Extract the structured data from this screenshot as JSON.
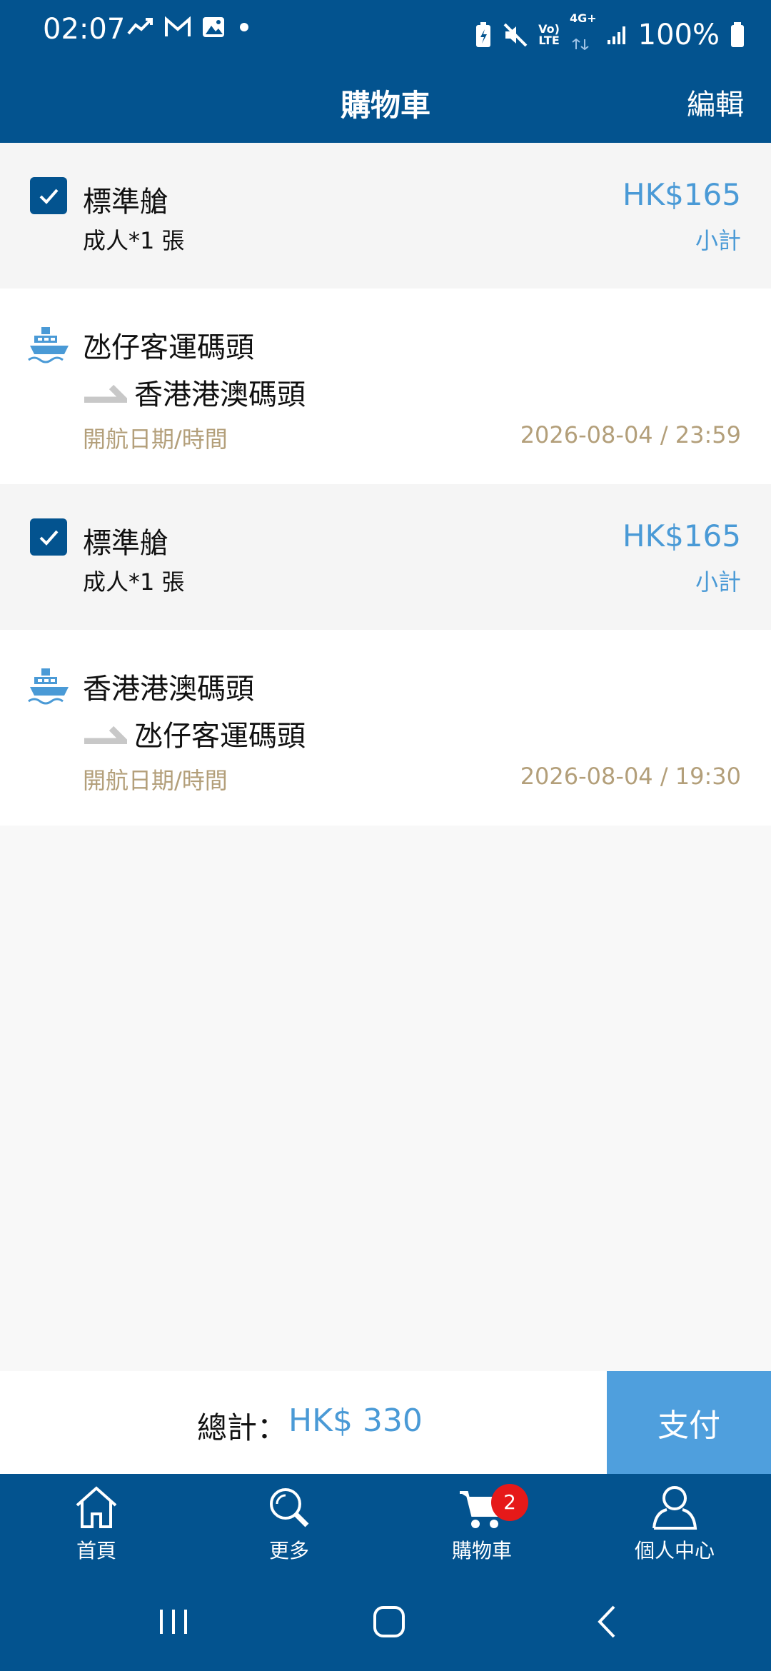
{
  "status_bar": {
    "time": "02:07",
    "battery": "100%",
    "volte_label_top": "Vo)",
    "volte_label_bottom": "LTE",
    "network_label": "4G+"
  },
  "header": {
    "title": "購物車",
    "edit_label": "編輯"
  },
  "cart_items": [
    {
      "title": "標準艙",
      "quantity": "成人*1 張",
      "price": "HK$165",
      "subtotal_label": "小計",
      "route": {
        "from": "氹仔客運碼頭",
        "to": "香港港澳碼頭",
        "datetime_label": "開航日期/時間",
        "datetime": "2026-08-04 / 23:59"
      }
    },
    {
      "title": "標準艙",
      "quantity": "成人*1 張",
      "price": "HK$165",
      "subtotal_label": "小計",
      "route": {
        "from": "香港港澳碼頭",
        "to": "氹仔客運碼頭",
        "datetime_label": "開航日期/時間",
        "datetime": "2026-08-04 / 19:30"
      }
    }
  ],
  "total": {
    "label": "總計：",
    "amount": "HK$ 330",
    "pay_label": "支付"
  },
  "bottom_nav": {
    "items": [
      {
        "label": "首頁",
        "icon": "home-icon"
      },
      {
        "label": "更多",
        "icon": "search-icon"
      },
      {
        "label": "購物車",
        "icon": "cart-icon",
        "badge": "2"
      },
      {
        "label": "個人中心",
        "icon": "person-icon"
      }
    ]
  },
  "colors": {
    "brand": "#03538f",
    "accent": "#4a9ad6",
    "pay": "#4f9fdd",
    "muted_gold": "#b39f7a",
    "badge": "#e61919"
  }
}
